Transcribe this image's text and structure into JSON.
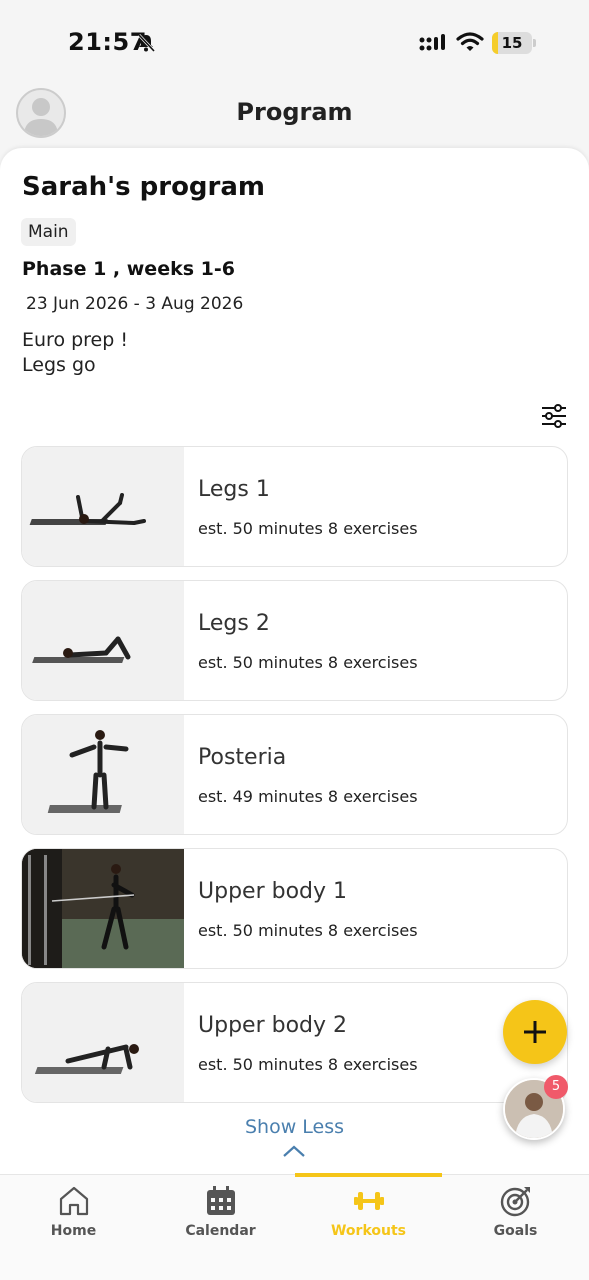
{
  "status_bar": {
    "time": "21:57",
    "battery": "15",
    "battery_level": 0.15
  },
  "header": {
    "title": "Program"
  },
  "program": {
    "title": "Sarah's program",
    "tag": "Main",
    "phase": "Phase 1 , weeks 1-6",
    "dates": "23 Jun 2026 - 3 Aug 2026",
    "description": "Euro prep !\nLegs go"
  },
  "workouts": [
    {
      "name": "Legs 1",
      "meta": "est. 50 minutes  8 exercises"
    },
    {
      "name": "Legs 2",
      "meta": "est. 50 minutes  8 exercises"
    },
    {
      "name": "Posteria",
      "meta": "est. 49 minutes  8 exercises"
    },
    {
      "name": "Upper body 1",
      "meta": "est. 50 minutes  8 exercises"
    },
    {
      "name": "Upper body 2",
      "meta": "est. 50 minutes  8 exercises"
    }
  ],
  "show_less_label": "Show Less",
  "chat_badge": "5",
  "tabs": [
    {
      "label": "Home"
    },
    {
      "label": "Calendar"
    },
    {
      "label": "Workouts"
    },
    {
      "label": "Goals"
    }
  ],
  "colors": {
    "accent": "#f5c518",
    "link": "#4a7fae",
    "badge": "#f05a6a"
  }
}
